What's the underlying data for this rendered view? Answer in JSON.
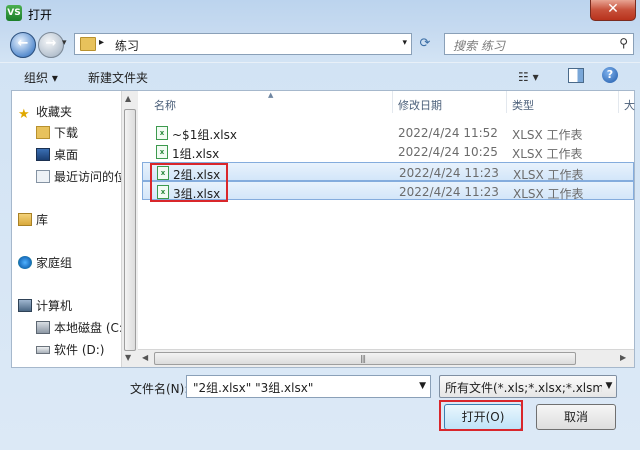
{
  "window": {
    "title": "打开",
    "app_icon": "VS",
    "close_glyph": "✕"
  },
  "address_bar": {
    "path_arrow": "▸",
    "folder": "练习",
    "dropdown": "▾"
  },
  "search": {
    "placeholder": "搜索 练习",
    "icon": "⚲"
  },
  "toolbar": {
    "organize": "组织 ▾",
    "new_folder": "新建文件夹",
    "view": "☷ ▾",
    "help": "?"
  },
  "nav": {
    "favorites": "收藏夹",
    "downloads": "下载",
    "desktop": "桌面",
    "recent": "最近访问的位",
    "libraries": "库",
    "homegroup": "家庭组",
    "computer": "计算机",
    "local_disk": "本地磁盘 (C:",
    "software": "软件 (D:)"
  },
  "columns": {
    "name": "名称",
    "date": "修改日期",
    "type": "类型",
    "size": "大"
  },
  "files": [
    {
      "name": "~$1组.xlsx",
      "date": "2022/4/24 11:52",
      "type": "XLSX 工作表"
    },
    {
      "name": "1组.xlsx",
      "date": "2022/4/24 10:25",
      "type": "XLSX 工作表"
    },
    {
      "name": "2组.xlsx",
      "date": "2022/4/24 11:23",
      "type": "XLSX 工作表"
    },
    {
      "name": "3组.xlsx",
      "date": "2022/4/24 11:23",
      "type": "XLSX 工作表"
    }
  ],
  "footer": {
    "filename_label": "文件名(N):",
    "filename_value": "\"2组.xlsx\" \"3组.xlsx\"",
    "filetype_value": "所有文件(*.xls;*.xlsx;*.xlsm;*.csv",
    "open_button": "打开(O)",
    "cancel_button": "取消"
  },
  "colors": {
    "highlight": "#d9262b",
    "selection": "#d3e6f9"
  }
}
